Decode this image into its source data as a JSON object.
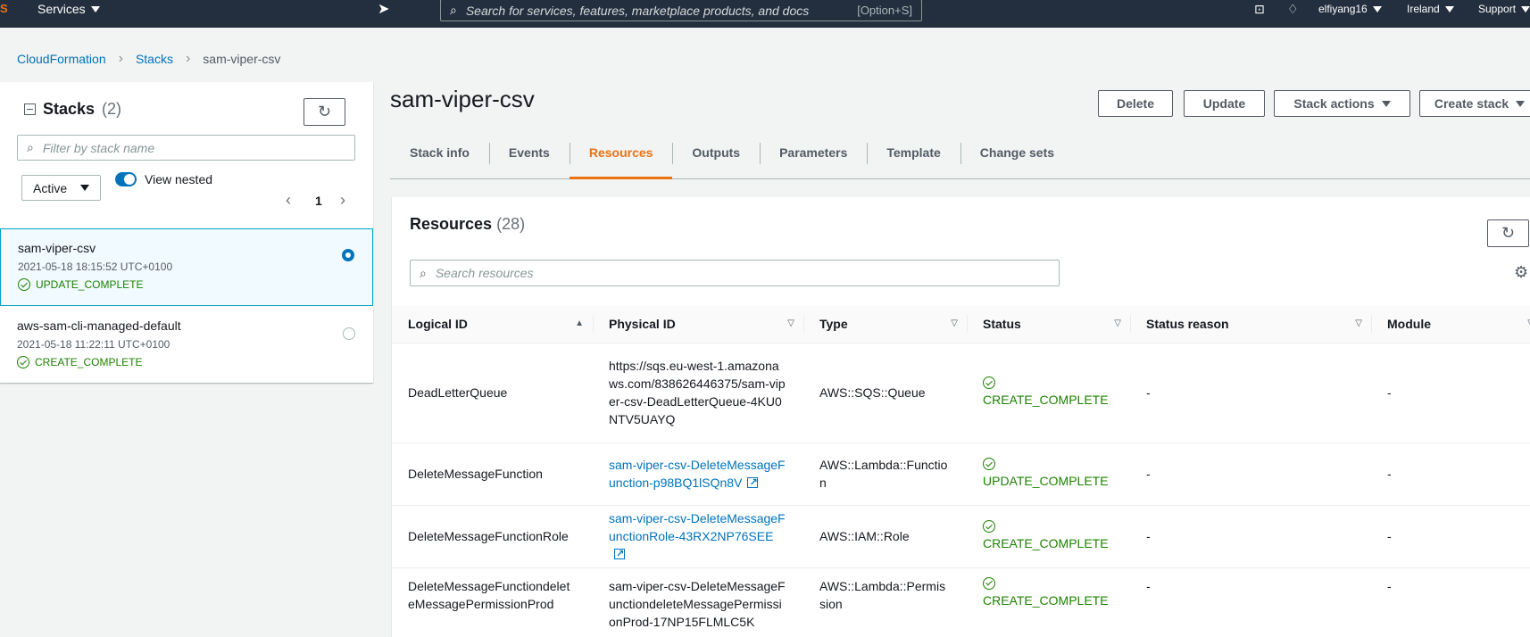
{
  "topnav": {
    "logo": "S",
    "services_label": "Services",
    "search_placeholder": "Search for services, features, marketplace products, and docs",
    "search_shortcut": "[Option+S]",
    "user": "elfiyang16",
    "region": "Ireland",
    "support": "Support"
  },
  "breadcrumb": {
    "root": "CloudFormation",
    "stacks": "Stacks",
    "current": "sam-viper-csv"
  },
  "left_panel": {
    "title": "Stacks",
    "count": "(2)",
    "filter_placeholder": "Filter by stack name",
    "status_filter": "Active",
    "view_nested_label": "View nested",
    "view_nested_on": true,
    "page": "1",
    "stacks": [
      {
        "name": "sam-viper-csv",
        "date": "2021-05-18 18:15:52 UTC+0100",
        "status": "UPDATE_COMPLETE",
        "selected": true
      },
      {
        "name": "aws-sam-cli-managed-default",
        "date": "2021-05-18 11:22:11 UTC+0100",
        "status": "CREATE_COMPLETE",
        "selected": false
      }
    ]
  },
  "main": {
    "title": "sam-viper-csv",
    "actions": {
      "delete": "Delete",
      "update": "Update",
      "stack_actions": "Stack actions",
      "create_stack": "Create stack"
    },
    "tabs": [
      "Stack info",
      "Events",
      "Resources",
      "Outputs",
      "Parameters",
      "Template",
      "Change sets"
    ],
    "active_tab": "Resources"
  },
  "resources": {
    "title": "Resources",
    "count": "(28)",
    "search_placeholder": "Search resources",
    "columns": [
      "Logical ID",
      "Physical ID",
      "Type",
      "Status",
      "Status reason",
      "Module"
    ],
    "rows": [
      {
        "logical_id": "DeadLetterQueue",
        "physical_id": "https://sqs.eu-west-1.amazonaws.com/838626446375/sam-viper-csv-DeadLetterQueue-4KU0NTV5UAYQ",
        "is_link": false,
        "type": "AWS::SQS::Queue",
        "status": "CREATE_COMPLETE",
        "reason": "-",
        "module": "-"
      },
      {
        "logical_id": "DeleteMessageFunction",
        "physical_id": "sam-viper-csv-DeleteMessageFunction-p98BQ1lSQn8V",
        "is_link": true,
        "type": "AWS::Lambda::Function",
        "status": "UPDATE_COMPLETE",
        "reason": "-",
        "module": "-"
      },
      {
        "logical_id": "DeleteMessageFunctionRole",
        "physical_id": "sam-viper-csv-DeleteMessageFunctionRole-43RX2NP76SEE",
        "is_link": true,
        "type": "AWS::IAM::Role",
        "status": "CREATE_COMPLETE",
        "reason": "-",
        "module": "-"
      },
      {
        "logical_id": "DeleteMessageFunctiondeleteMessagePermissionProd",
        "physical_id": "sam-viper-csv-DeleteMessageFunctiondeleteMessagePermissionProd-17NP15FLMLC5K",
        "is_link": false,
        "type": "AWS::Lambda::Permission",
        "status": "CREATE_COMPLETE",
        "reason": "-",
        "module": "-"
      }
    ]
  },
  "colors": {
    "nav_bg": "#232f3e",
    "accent": "#ec7211",
    "link": "#0073bb",
    "success": "#1d8102"
  }
}
